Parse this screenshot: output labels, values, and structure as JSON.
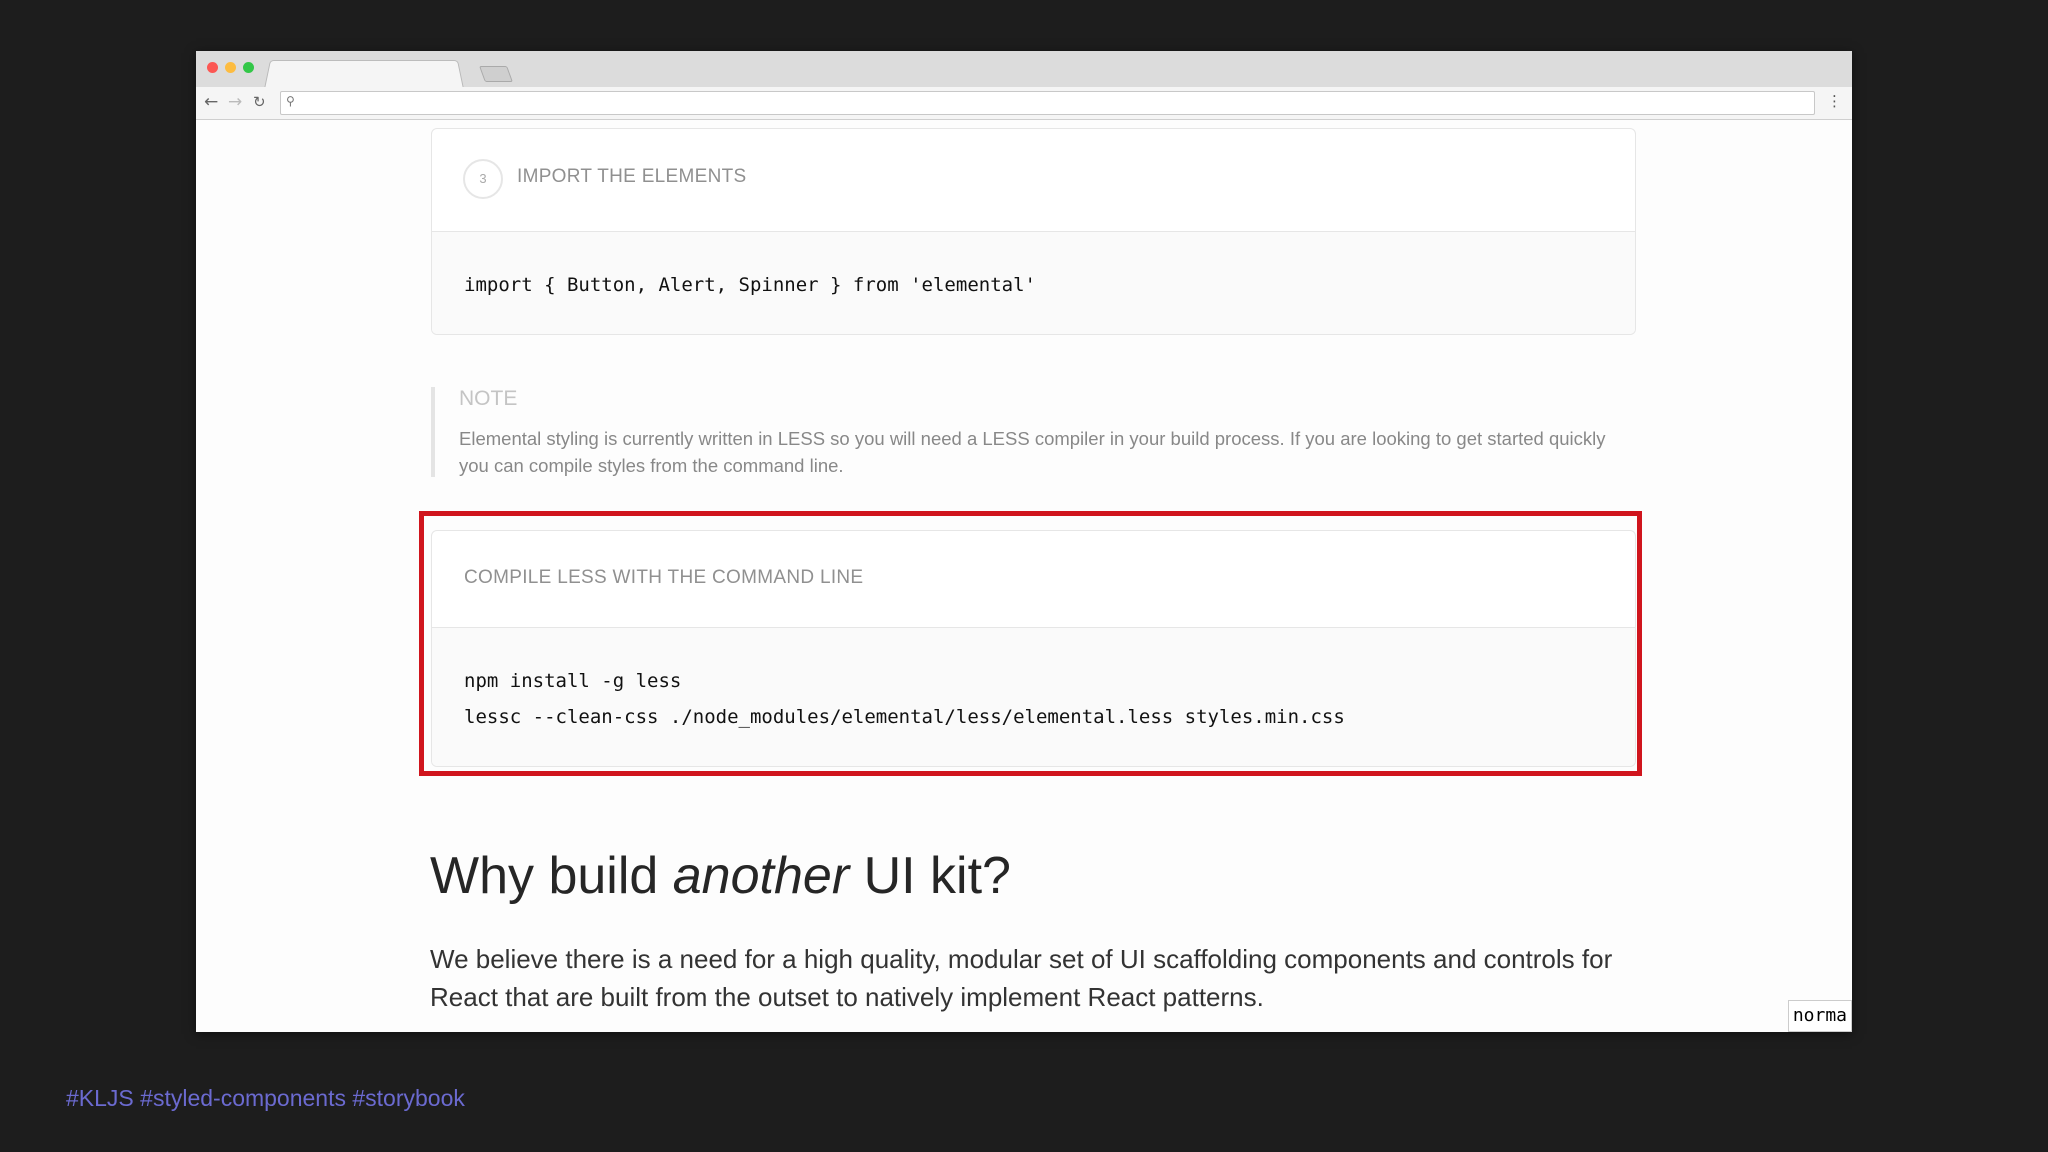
{
  "browser": {
    "back_icon": "arrow-left-icon",
    "forward_icon": "arrow-right-icon",
    "reload_icon": "reload-icon",
    "search_icon": "magnifier-icon",
    "menu_icon": "vertical-dots-icon",
    "address_value": ""
  },
  "step_card": {
    "number": "3",
    "title": "IMPORT THE ELEMENTS",
    "code": "import { Button, Alert, Spinner } from 'elemental'"
  },
  "note": {
    "label": "NOTE",
    "text": "Elemental styling is currently written in LESS so you will need a LESS compiler in your build process. If you are looking to get started quickly you can compile styles from the command line."
  },
  "compile_card": {
    "title": "COMPILE LESS WITH THE COMMAND LINE",
    "code_line1": "npm install -g less",
    "code_line2": "lessc --clean-css ./node_modules/elemental/less/elemental.less styles.min.css",
    "highlight_color": "#d0151d"
  },
  "section": {
    "heading_pre": "Why build ",
    "heading_em": "another",
    "heading_post": " UI kit?",
    "paragraph": "We believe there is a need for a high quality, modular set of UI scaffolding components and controls for React that are built from the outset to natively implement React patterns."
  },
  "mode_badge": "norma",
  "hashtags": "#KLJS #styled-components #storybook",
  "colors": {
    "background": "#1d1d1d",
    "hashtag": "#6b6ad0"
  }
}
